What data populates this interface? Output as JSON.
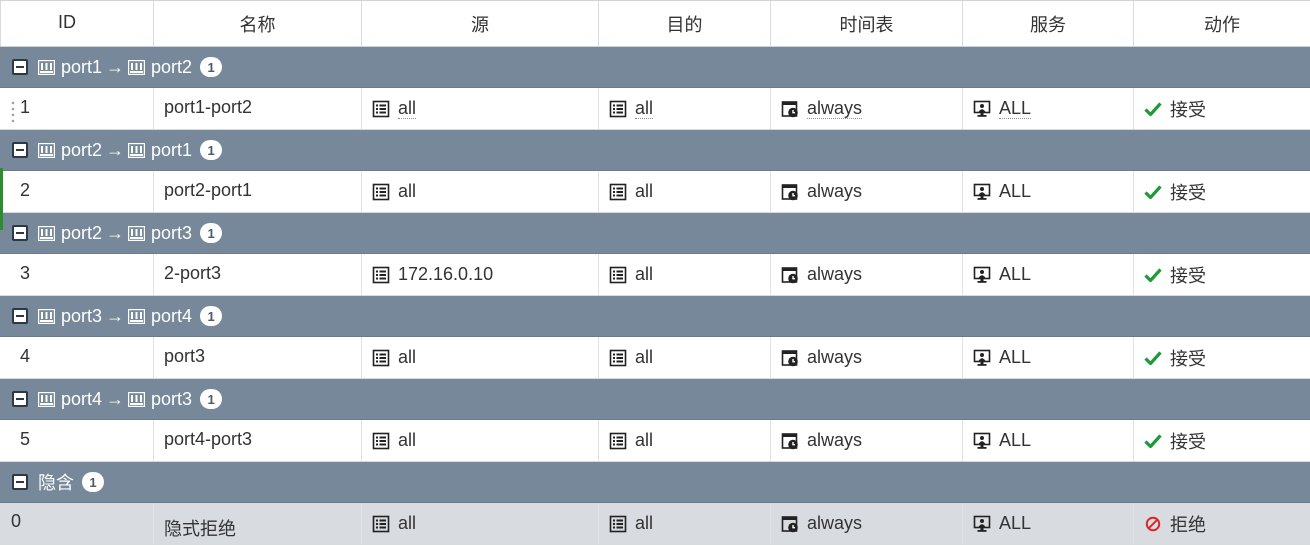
{
  "columns": {
    "id": "ID",
    "name": "名称",
    "source": "源",
    "destination": "目的",
    "schedule": "时间表",
    "service": "服务",
    "action": "动作"
  },
  "groups": [
    {
      "from": "port1",
      "arrow": "→",
      "to": "port2",
      "count": "1",
      "policy": {
        "id": "1",
        "name": "port1-port2",
        "source": "all",
        "destination": "all",
        "schedule": "always",
        "service": "ALL",
        "action": "接受"
      }
    },
    {
      "from": "port2",
      "arrow": "→",
      "to": "port1",
      "count": "1",
      "policy": {
        "id": "2",
        "name": "port2-port1",
        "source": "all",
        "destination": "all",
        "schedule": "always",
        "service": "ALL",
        "action": "接受"
      }
    },
    {
      "from": "port2",
      "arrow": "→",
      "to": "port3",
      "count": "1",
      "policy": {
        "id": "3",
        "name": "2-port3",
        "source": "172.16.0.10",
        "destination": "all",
        "schedule": "always",
        "service": "ALL",
        "action": "接受"
      }
    },
    {
      "from": "port3",
      "arrow": "→",
      "to": "port4",
      "count": "1",
      "policy": {
        "id": "4",
        "name": "port3",
        "source": "all",
        "destination": "all",
        "schedule": "always",
        "service": "ALL",
        "action": "接受"
      }
    },
    {
      "from": "port4",
      "arrow": "→",
      "to": "port3",
      "count": "1",
      "policy": {
        "id": "5",
        "name": "port4-port3",
        "source": "all",
        "destination": "all",
        "schedule": "always",
        "service": "ALL",
        "action": "接受"
      }
    }
  ],
  "implicit": {
    "label": "隐含",
    "count": "1",
    "policy": {
      "id": "0",
      "name": "隐式拒绝",
      "source": "all",
      "destination": "all",
      "schedule": "always",
      "service": "ALL",
      "action": "拒绝"
    }
  },
  "colors": {
    "group_bar": "#76889a",
    "accept": "#1e9a3a",
    "deny": "#d9262d",
    "implicit_row": "#d8dbdf"
  },
  "icons": {
    "collapse": "collapse-icon",
    "interface": "interface-port-icon",
    "address": "address-list-icon",
    "schedule": "schedule-clock-icon",
    "service": "service-monitor-icon",
    "accept": "checkmark-icon",
    "deny": "deny-circle-icon"
  }
}
